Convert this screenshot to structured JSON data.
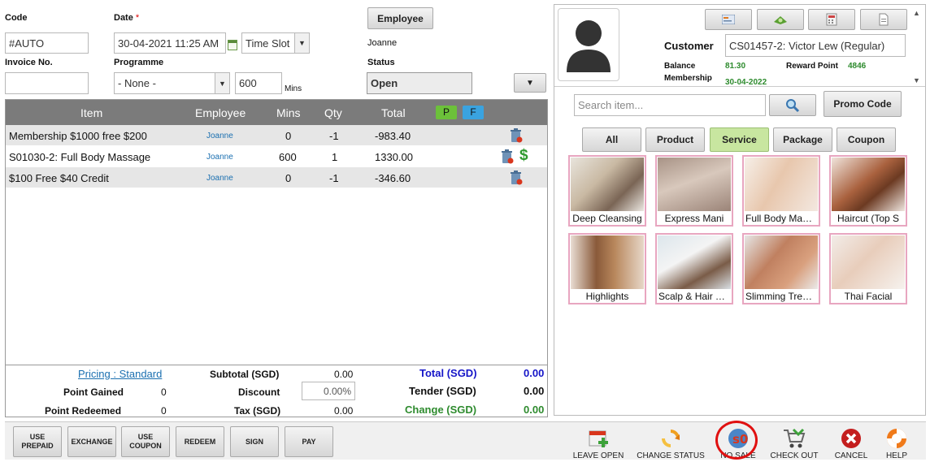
{
  "form": {
    "code_label": "Code",
    "code_value": "#AUTO",
    "date_label": "Date",
    "date_required": "*",
    "date_value": "30-04-2021 11:25 AM",
    "timeslot_value": "Time Slot",
    "employee_button": "Employee",
    "employee_name": "Joanne",
    "invoice_label": "Invoice No.",
    "invoice_value": "",
    "programme_label": "Programme",
    "programme_value": "- None -",
    "mins_value": "600",
    "mins_unit": "Mins",
    "status_label": "Status",
    "status_value": "Open"
  },
  "table": {
    "headers": {
      "item": "Item",
      "employee": "Employee",
      "mins": "Mins",
      "qty": "Qty",
      "total": "Total",
      "badge_p": "P",
      "badge_f": "F"
    },
    "rows": [
      {
        "item": "Membership $1000 free $200",
        "employee": "Joanne",
        "mins": "0",
        "qty": "-1",
        "total": "-983.40"
      },
      {
        "item": "S01030-2: Full Body Massage",
        "employee": "Joanne",
        "mins": "600",
        "qty": "1",
        "total": "1330.00"
      },
      {
        "item": "$100 Free $40 Credit",
        "employee": "Joanne",
        "mins": "0",
        "qty": "-1",
        "total": "-346.60"
      }
    ],
    "currency_icon": "$"
  },
  "totals": {
    "pricing": "Pricing : Standard",
    "subtotal_label": "Subtotal (SGD)",
    "subtotal_value": "0.00",
    "total_label": "Total (SGD)",
    "total_value": "0.00",
    "point_gained_label": "Point Gained",
    "point_gained_value": "0",
    "discount_label": "Discount",
    "discount_value": "0.00%",
    "tender_label": "Tender (SGD)",
    "tender_value": "0.00",
    "point_redeemed_label": "Point Redeemed",
    "point_redeemed_value": "0",
    "tax_label": "Tax (SGD)",
    "tax_value": "0.00",
    "change_label": "Change (SGD)",
    "change_value": "0.00"
  },
  "customer": {
    "label": "Customer",
    "value": "CS01457-2: Victor Lew (Regular)",
    "balance_label": "Balance",
    "balance_value": "81.30",
    "reward_label": "Reward Point",
    "reward_value": "4846",
    "membership_label": "Membership",
    "membership_value": "30-04-2022"
  },
  "search": {
    "placeholder": "Search item...",
    "promo_button": "Promo Code"
  },
  "categories": [
    "All",
    "Product",
    "Service",
    "Package",
    "Coupon"
  ],
  "services": [
    "Deep Cleansing",
    "Express Mani",
    "Full Body Massage",
    "Haircut (Top S",
    "Highlights",
    "Scalp & Hair Treatment",
    "Slimming Treatment",
    "Thai Facial"
  ],
  "bottom_buttons": [
    [
      "USE",
      "PREPAID"
    ],
    [
      "EXCHANGE"
    ],
    [
      "USE",
      "COUPON"
    ],
    [
      "REDEEM"
    ],
    [
      "SIGN"
    ],
    [
      "PAY"
    ]
  ],
  "actions": [
    "LEAVE OPEN",
    "CHANGE STATUS",
    "NO SALE",
    "CHECK OUT",
    "CANCEL",
    "HELP"
  ],
  "colors": {
    "accent_green": "#2e8b2e",
    "link_blue": "#1a6fb0",
    "total_blue": "#1515c8",
    "highlight_red": "#e01010",
    "tile_border": "#e8a6c0",
    "service_active": "#c8e6a0"
  }
}
